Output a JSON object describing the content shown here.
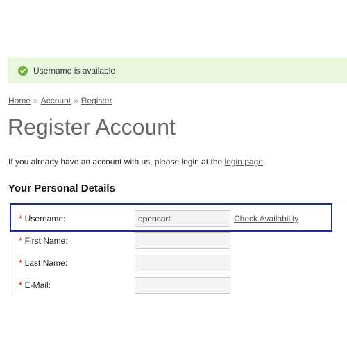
{
  "alert": {
    "message": "Username is available",
    "icon": "check-circle-icon",
    "accent_color": "#6db33f"
  },
  "breadcrumb": {
    "items": [
      "Home",
      "Account",
      "Register"
    ],
    "separator": "»"
  },
  "page": {
    "title": "Register Account",
    "intro_text": "If you already have an account with us, please login at the ",
    "intro_link": "login page",
    "intro_end": "."
  },
  "section": {
    "heading": "Your Personal Details"
  },
  "form": {
    "required_marker": "*",
    "username_label": "Username:",
    "username_value": "opencart",
    "check_availability": "Check Availability",
    "firstname_label": "First Name:",
    "lastname_label": "Last Name:",
    "email_label": "E-Mail:"
  },
  "colors": {
    "highlight_border": "#1d2d8c",
    "required": "#ff0000"
  }
}
